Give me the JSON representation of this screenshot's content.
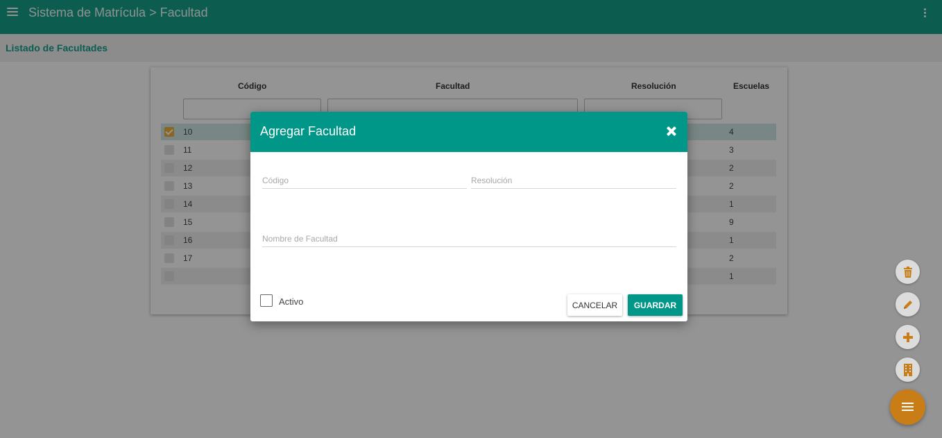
{
  "app": {
    "title": "Sistema de Matrícula > Facultad",
    "subtitle": "Listado de Facultades"
  },
  "table": {
    "columns": {
      "codigo": "Código",
      "facultad": "Facultad",
      "resolucion": "Resolución",
      "escuelas": "Escuelas"
    },
    "rows": [
      {
        "code": "10",
        "escuelas": "4",
        "checked": true
      },
      {
        "code": "11",
        "escuelas": "3",
        "checked": false
      },
      {
        "code": "12",
        "escuelas": "2",
        "checked": false
      },
      {
        "code": "13",
        "escuelas": "2",
        "checked": false
      },
      {
        "code": "14",
        "escuelas": "1",
        "checked": false
      },
      {
        "code": "15",
        "escuelas": "9",
        "checked": false
      },
      {
        "code": "16",
        "escuelas": "1",
        "checked": false
      },
      {
        "code": "17",
        "escuelas": "2",
        "checked": false
      },
      {
        "code": "",
        "escuelas": "1",
        "checked": false
      }
    ]
  },
  "modal": {
    "title": "Agregar Facultad",
    "fields": {
      "codigo_placeholder": "Código",
      "resolucion_placeholder": "Resolución",
      "nombre_placeholder": "Nombre de Facultad"
    },
    "activo_label": "Activo",
    "cancel_label": "CANCELAR",
    "save_label": "GUARDAR"
  },
  "fab_icons": [
    "trash-icon",
    "pencil-icon",
    "plus-icon",
    "building-icon",
    "menu-icon"
  ],
  "colors": {
    "primary": "#009688",
    "accent": "#c97d16",
    "checkbox": "#f0b03a"
  }
}
